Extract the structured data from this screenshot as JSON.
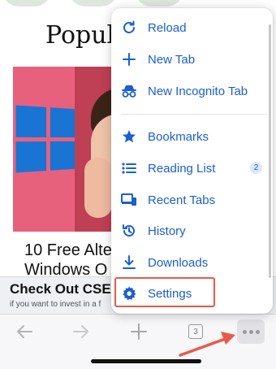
{
  "page": {
    "title": "Popul",
    "article_title_line1": "10 Free Alte",
    "article_title_line2": "Windows O",
    "ad_title": "Check Out CSE:",
    "ad_subtitle": "if you want to invest in a f"
  },
  "menu": {
    "items": [
      {
        "label": "Reload",
        "icon": "reload-icon"
      },
      {
        "label": "New Tab",
        "icon": "plus-icon"
      },
      {
        "label": "New Incognito Tab",
        "icon": "incognito-icon"
      },
      {
        "label": "Bookmarks",
        "icon": "star-icon"
      },
      {
        "label": "Reading List",
        "icon": "list-icon",
        "badge": "2"
      },
      {
        "label": "Recent Tabs",
        "icon": "recent-tabs-icon"
      },
      {
        "label": "History",
        "icon": "history-icon"
      },
      {
        "label": "Downloads",
        "icon": "download-icon"
      },
      {
        "label": "Settings",
        "icon": "gear-icon"
      }
    ],
    "accent_color": "#1a5fd2",
    "highlight_color": "#e85a4a"
  },
  "toolbar": {
    "tab_count": "3",
    "buttons": [
      "back-arrow-icon",
      "forward-arrow-icon",
      "plus-icon",
      "tab-switcher",
      "more-icon"
    ]
  }
}
